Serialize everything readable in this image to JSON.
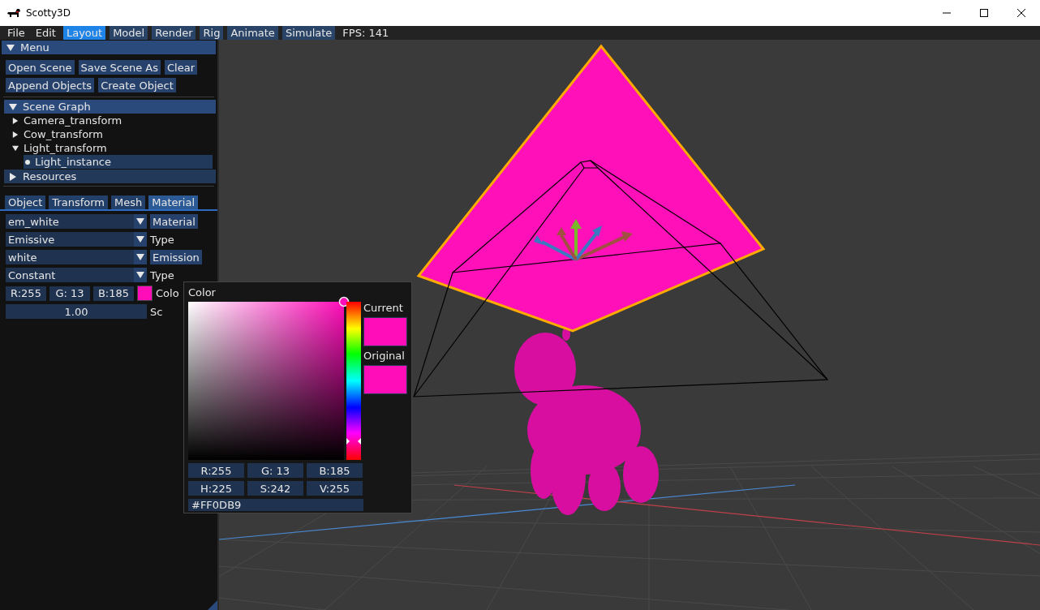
{
  "window": {
    "title": "Scotty3D"
  },
  "menu_bar": {
    "items": [
      {
        "label": "File",
        "kind": "plain",
        "selected": false
      },
      {
        "label": "Edit",
        "kind": "plain",
        "selected": false
      },
      {
        "label": "Layout",
        "kind": "mode",
        "selected": true
      },
      {
        "label": "Model",
        "kind": "mode",
        "selected": false
      },
      {
        "label": "Render",
        "kind": "mode",
        "selected": false
      },
      {
        "label": "Rig",
        "kind": "mode",
        "selected": false
      },
      {
        "label": "Animate",
        "kind": "mode",
        "selected": false
      },
      {
        "label": "Simulate",
        "kind": "mode",
        "selected": false
      }
    ],
    "fps": "FPS: 141"
  },
  "sidebar": {
    "menu": {
      "label": "Menu",
      "expanded": true
    },
    "buttons": [
      [
        "Open Scene",
        "Save Scene As",
        "Clear"
      ],
      [
        "Append Objects",
        "Create Object"
      ]
    ],
    "scene_graph": {
      "label": "Scene Graph",
      "expanded": true,
      "items": [
        {
          "label": "Camera_transform",
          "expanded": false,
          "selected": false
        },
        {
          "label": "Cow_transform",
          "expanded": false,
          "selected": false
        },
        {
          "label": "Light_transform",
          "expanded": true,
          "selected": false,
          "children": [
            {
              "label": "Light_instance",
              "selected": true
            }
          ]
        }
      ]
    },
    "resources": {
      "label": "Resources",
      "expanded": false
    },
    "tabs": [
      {
        "label": "Object",
        "selected": false
      },
      {
        "label": "Transform",
        "selected": false
      },
      {
        "label": "Mesh",
        "selected": false
      },
      {
        "label": "Material",
        "selected": true
      }
    ],
    "rows": [
      {
        "kind": "dropdown",
        "value": "em_white",
        "button": "Material"
      },
      {
        "kind": "dropdown",
        "value": "Emissive",
        "label": "Type"
      },
      {
        "kind": "dropdown",
        "value": "white",
        "button": "Emission"
      },
      {
        "kind": "dropdown",
        "value": "Constant",
        "label": "Type"
      },
      {
        "kind": "color",
        "fields": [
          "R:255",
          "G: 13",
          "B:185"
        ],
        "color": "#ff0db9",
        "label": "Colo"
      },
      {
        "kind": "slider",
        "value": "1.00",
        "label": "Sc"
      }
    ]
  },
  "color_picker": {
    "title": "Color",
    "current_label": "Current",
    "original_label": "Original",
    "rgb_fields": [
      "R:255",
      "G: 13",
      "B:185"
    ],
    "hsv_fields": [
      "H:225",
      "S:242",
      "V:255"
    ],
    "hex": "#FF0DB9"
  }
}
